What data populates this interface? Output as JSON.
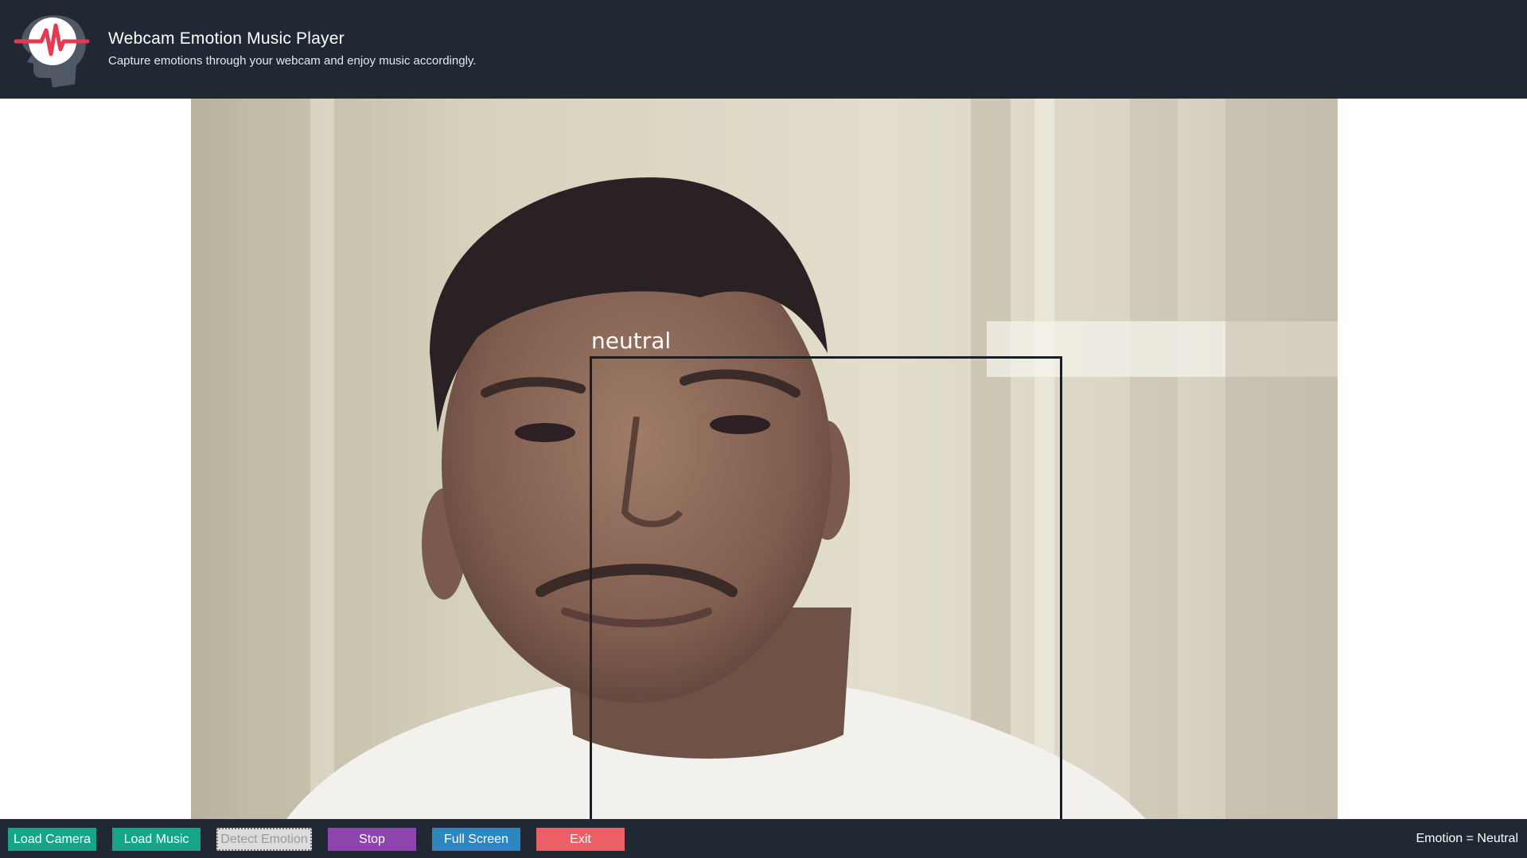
{
  "header": {
    "title": "Webcam Emotion Music Player",
    "subtitle": "Capture emotions through your webcam and enjoy music accordingly.",
    "logo_icon": "head-heartbeat-icon"
  },
  "video": {
    "face_label": "neutral"
  },
  "controls": {
    "load_camera": "Load Camera",
    "load_music": "Load Music",
    "detect_emotion": "Detect Emotion",
    "stop": "Stop",
    "full_screen": "Full Screen",
    "exit": "Exit"
  },
  "status": {
    "emotion_text": "Emotion = Neutral"
  },
  "colors": {
    "bar_background": "#1f2833",
    "green": "#17a589",
    "purple": "#8e44ad",
    "blue": "#2e86c1",
    "red": "#ec5f67",
    "disabled": "#dcdcdc"
  }
}
